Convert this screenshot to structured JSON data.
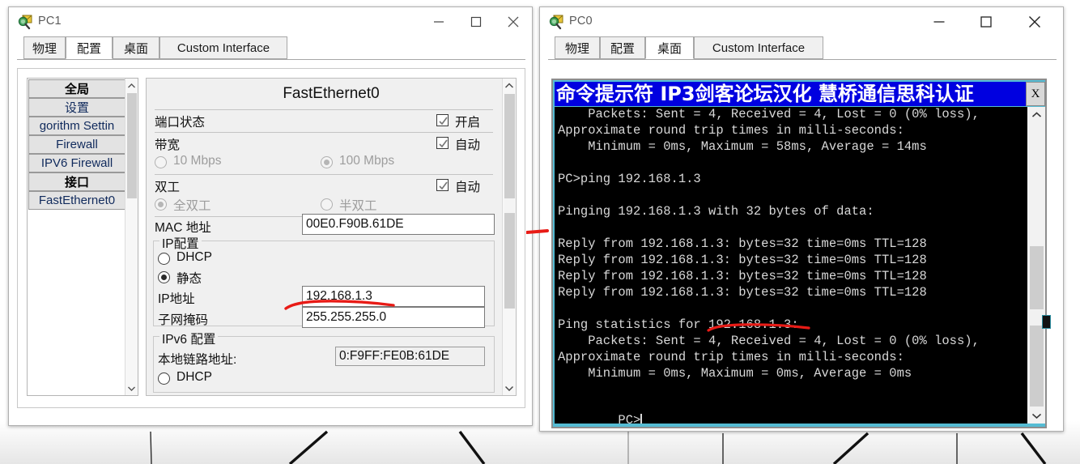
{
  "pc1_window": {
    "title": "PC1",
    "icon": "inspect-magnifier-icon",
    "controls": {
      "minimize": "–",
      "maximize": "□",
      "close": "✕"
    },
    "tabs": [
      {
        "label": "物理",
        "selected": false
      },
      {
        "label": "配置",
        "selected": true
      },
      {
        "label": "桌面",
        "selected": false
      },
      {
        "label": "Custom Interface",
        "selected": false
      }
    ],
    "sidebar": {
      "items": [
        {
          "label": "全局",
          "bold": true
        },
        {
          "label": "设置",
          "bold": false
        },
        {
          "label": "gorithm Settin",
          "bold": false
        },
        {
          "label": "Firewall",
          "bold": false
        },
        {
          "label": "IPV6 Firewall",
          "bold": false
        },
        {
          "label": "接口",
          "bold": true
        },
        {
          "label": "FastEthernet0",
          "bold": false
        }
      ]
    },
    "config": {
      "panel_title": "FastEthernet0",
      "port_status_label": "端口状态",
      "port_status_check": {
        "label": "开启",
        "checked": true
      },
      "bandwidth_label": "带宽",
      "bandwidth_auto": {
        "label": "自动",
        "checked": true
      },
      "bandwidth_options": [
        {
          "label": "10 Mbps",
          "selected": false
        },
        {
          "label": "100 Mbps",
          "selected": true
        }
      ],
      "duplex_label": "双工",
      "duplex_auto": {
        "label": "自动",
        "checked": true
      },
      "duplex_options": [
        {
          "label": "全双工",
          "selected": true
        },
        {
          "label": "半双工",
          "selected": false
        }
      ],
      "mac_label": "MAC 地址",
      "mac_value": "00E0.F90B.61DE",
      "ip_group_label": "IP配置",
      "ip_dhcp": {
        "label": "DHCP",
        "selected": false
      },
      "ip_static": {
        "label": "静态",
        "selected": true
      },
      "ip_address_label": "IP地址",
      "ip_address_value": "192.168.1.3",
      "subnet_label": "子网掩码",
      "subnet_value": "255.255.255.0",
      "ipv6_group_label": "IPv6 配置",
      "link_local_label": "本地链路地址:",
      "link_local_value": "0:F9FF:FE0B:61DE",
      "ipv6_dhcp": {
        "label": "DHCP",
        "selected": false
      }
    }
  },
  "pc0_window": {
    "title": "PC0",
    "icon": "inspect-magnifier-icon",
    "controls": {
      "minimize": "–",
      "maximize": "□",
      "close": "✕"
    },
    "tabs": [
      {
        "label": "物理",
        "selected": false
      },
      {
        "label": "配置",
        "selected": false
      },
      {
        "label": "桌面",
        "selected": true
      },
      {
        "label": "Custom Interface",
        "selected": false
      }
    ],
    "terminal": {
      "title": "命令提示符      IP3剑客论坛汉化    慧桥通信思科认证",
      "close_label": "X",
      "lines": [
        "    Packets: Sent = 4, Received = 4, Lost = 0 (0% loss),",
        "Approximate round trip times in milli-seconds:",
        "    Minimum = 0ms, Maximum = 58ms, Average = 14ms",
        "",
        "PC>ping 192.168.1.3",
        "",
        "Pinging 192.168.1.3 with 32 bytes of data:",
        "",
        "Reply from 192.168.1.3: bytes=32 time=0ms TTL=128",
        "Reply from 192.168.1.3: bytes=32 time=0ms TTL=128",
        "Reply from 192.168.1.3: bytes=32 time=0ms TTL=128",
        "Reply from 192.168.1.3: bytes=32 time=0ms TTL=128",
        "",
        "Ping statistics for 192.168.1.3:",
        "    Packets: Sent = 4, Received = 4, Lost = 0 (0% loss),",
        "Approximate round trip times in milli-seconds:",
        "    Minimum = 0ms, Maximum = 0ms, Average = 0ms",
        "",
        "PC>"
      ]
    }
  },
  "annotations": {
    "accent_red": "#e81b16",
    "title_blue": "#0000e0",
    "frame_cyan": "#55bcd4"
  }
}
